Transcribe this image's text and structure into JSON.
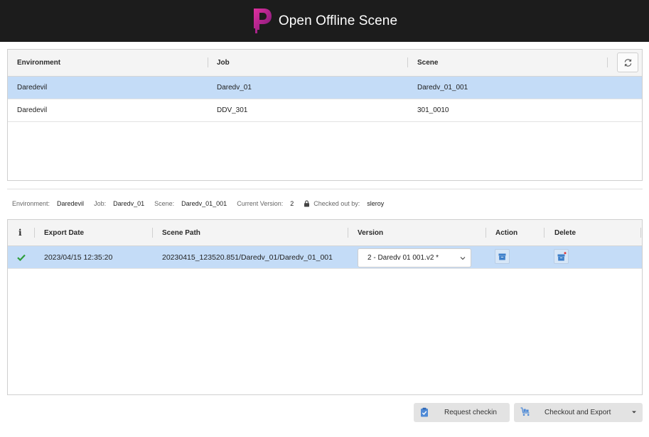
{
  "window": {
    "title": "Open Offline Scene"
  },
  "scenes_table": {
    "headers": {
      "environment": "Environment",
      "job": "Job",
      "scene": "Scene"
    },
    "rows": [
      {
        "environment": "Daredevil",
        "job": "Daredv_01",
        "scene": "Daredv_01_001"
      },
      {
        "environment": "Daredevil",
        "job": "DDV_301",
        "scene": "301_0010"
      }
    ]
  },
  "info": {
    "environment_label": "Environment:",
    "environment_value": "Daredevil",
    "job_label": "Job:",
    "job_value": "Daredv_01",
    "scene_label": "Scene:",
    "scene_value": "Daredv_01_001",
    "version_label": "Current Version:",
    "version_value": "2",
    "checked_out_label": "Checked out by:",
    "checked_out_value": "sleroy"
  },
  "exports_table": {
    "headers": {
      "info": "i",
      "export_date": "Export Date",
      "scene_path": "Scene Path",
      "version": "Version",
      "action": "Action",
      "delete": "Delete"
    },
    "rows": [
      {
        "status": "check-icon",
        "export_date": "2023/04/15 12:35:20",
        "scene_path": "20230415_123520.851/Daredv_01/Daredv_01_001",
        "version": "2 - Daredv  01  001.v2 *"
      }
    ]
  },
  "footer": {
    "request_checkin_label": "Request checkin",
    "checkout_export_label": "Checkout and Export"
  },
  "colors": {
    "titlebar": "#1c1c1c",
    "logo": "#c2198c",
    "selected_row": "#c4dcf7",
    "accent_icon": "#3d7fc9",
    "success": "#2e9e3c"
  }
}
